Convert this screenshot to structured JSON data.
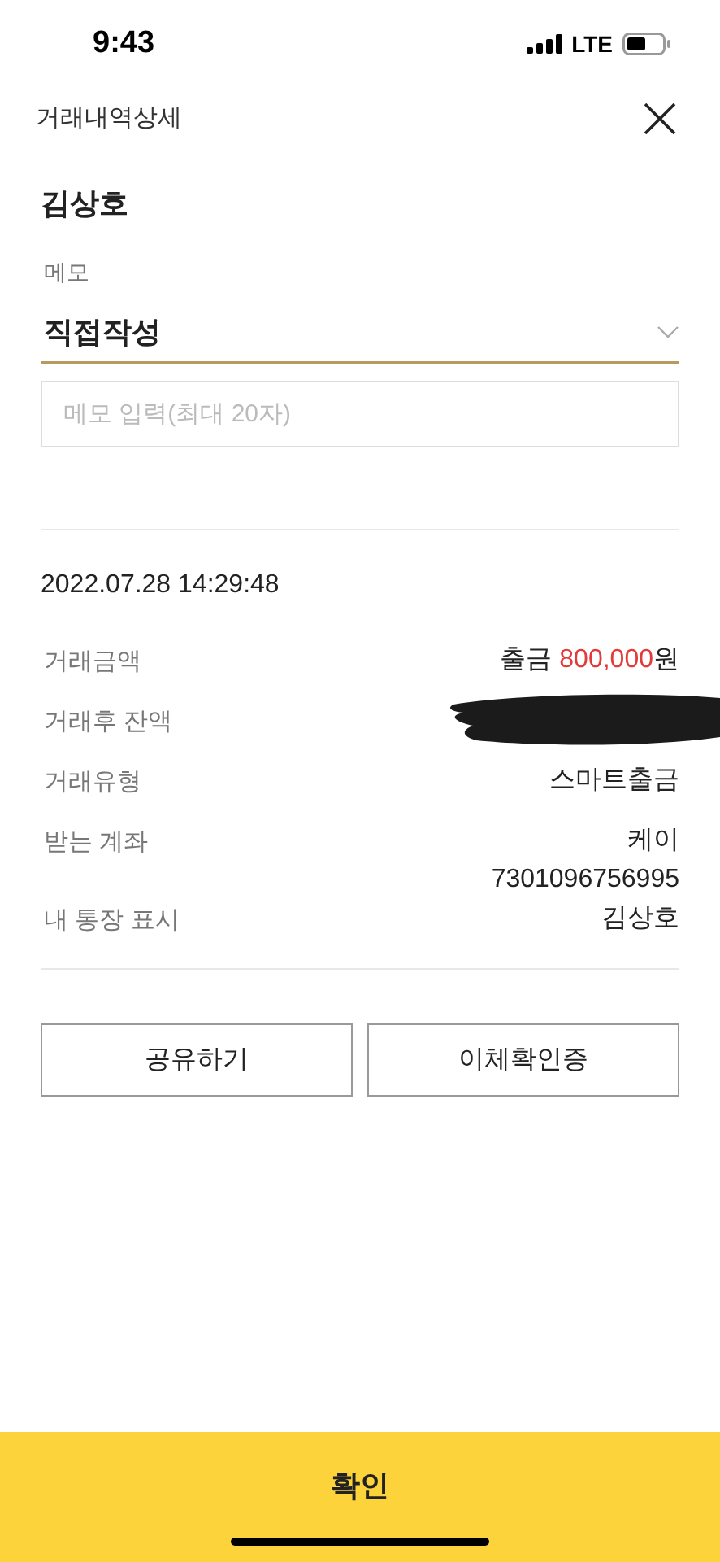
{
  "status_bar": {
    "time": "9:43",
    "network": "LTE"
  },
  "header": {
    "title": "거래내역상세"
  },
  "recipient": "김상호",
  "memo": {
    "label": "메모",
    "selected": "직접작성",
    "placeholder": "메모 입력(최대 20자)"
  },
  "datetime": "2022.07.28 14:29:48",
  "details": [
    {
      "kind": "amount",
      "label": "거래금액",
      "prefix": "출금",
      "amount": "800,000",
      "unit": "원"
    },
    {
      "kind": "redacted",
      "label": "거래후 잔액"
    },
    {
      "kind": "text",
      "label": "거래유형",
      "lines": [
        "스마트출금"
      ]
    },
    {
      "kind": "text",
      "label": "받는 계좌",
      "lines": [
        "케이",
        "7301096756995"
      ]
    },
    {
      "kind": "text",
      "label": "내 통장 표시",
      "lines": [
        "김상호"
      ]
    }
  ],
  "buttons": [
    "공유하기",
    "이체확인증"
  ],
  "confirm": "확인"
}
